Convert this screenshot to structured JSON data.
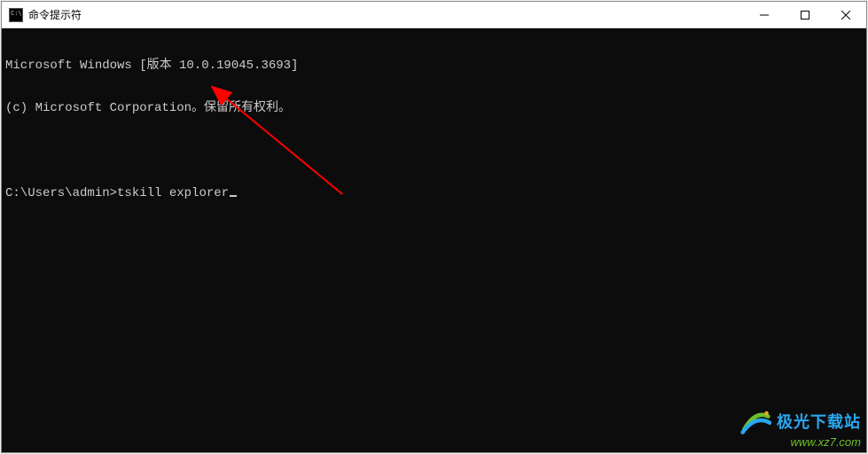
{
  "window": {
    "title": "命令提示符"
  },
  "terminal": {
    "line1": "Microsoft Windows [版本 10.0.19045.3693]",
    "line2": "(c) Microsoft Corporation。保留所有权利。",
    "prompt": "C:\\Users\\admin>",
    "command": "tskill explorer"
  },
  "watermark": {
    "brand": "极光下载站",
    "url": "www.xz7.com"
  },
  "colors": {
    "arrow": "#ff0000",
    "terminal_bg": "#0c0c0c",
    "terminal_fg": "#cccccc",
    "watermark_brand": "#2aa7f0",
    "watermark_url": "#6ec12b"
  }
}
